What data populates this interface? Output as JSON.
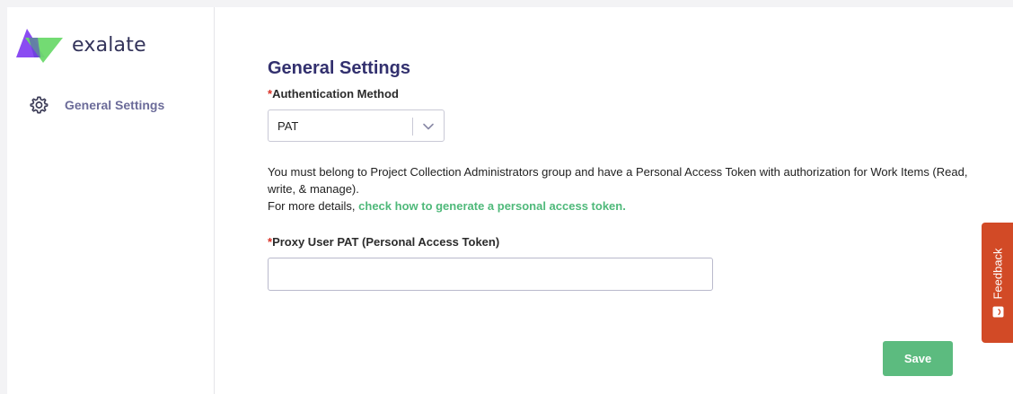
{
  "brand": {
    "name": "exalate",
    "colors": {
      "logo_purple": "#8a4cf2",
      "logo_green": "#6bd96b",
      "title": "#32306e",
      "accent_green": "#4fb97a",
      "save_button": "#5cbb7f",
      "feedback_tab": "#d24a26",
      "required_mark": "#d93025"
    }
  },
  "sidebar": {
    "items": [
      {
        "label": "General Settings",
        "icon": "gear-icon"
      }
    ]
  },
  "main": {
    "title": "General Settings",
    "auth_method": {
      "required_mark": "*",
      "label": "Authentication Method",
      "selected": "PAT"
    },
    "help": {
      "line1": "You must belong to Project Collection Administrators group and have a Personal Access Token with authorization for Work Items (Read, write, & manage).",
      "line2_prefix": "For more details, ",
      "link": "check how to generate a personal access token."
    },
    "pat_field": {
      "required_mark": "*",
      "label": "Proxy User PAT (Personal Access Token)",
      "value": ""
    },
    "save_label": "Save"
  },
  "feedback": {
    "label": "Feedback",
    "icon": "feedback-smiley-icon"
  }
}
